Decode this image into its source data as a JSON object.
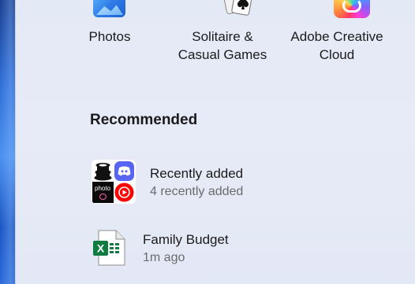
{
  "pinned": [
    {
      "label_line1": "Photos",
      "label_line2": "",
      "icon": "photos-icon"
    },
    {
      "label_line1": "Solitaire &",
      "label_line2": "Casual Games",
      "icon": "solitaire-icon"
    },
    {
      "label_line1": "Adobe Creative",
      "label_line2": "Cloud",
      "icon": "adobe-creative-cloud-icon"
    }
  ],
  "recommended": {
    "title": "Recommended",
    "items": [
      {
        "title": "Recently added",
        "subtitle": "4 recently added",
        "icon": "recently-added-apps-icon"
      },
      {
        "title": "Family Budget",
        "subtitle": "1m ago",
        "icon": "excel-file-icon"
      }
    ]
  },
  "cluster_labels": {
    "photo_app": "photo"
  },
  "excel_letter": "X",
  "colors": {
    "panel_bg": "#e5eaf6",
    "text_primary": "#1b1b1b",
    "text_secondary": "#6b6b6b",
    "discord": "#5865f2",
    "youtube_music": "#ff0000",
    "excel_green": "#107c41"
  }
}
